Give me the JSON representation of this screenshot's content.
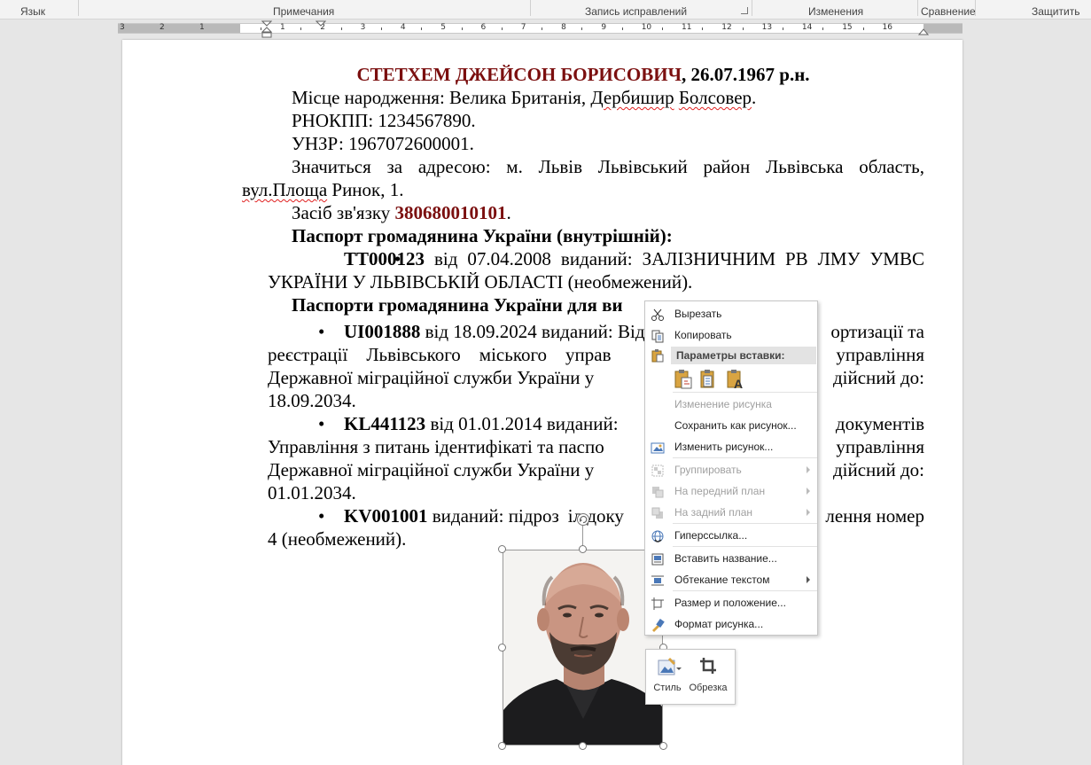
{
  "ribbon": {
    "groups": [
      "Язык",
      "Примечания",
      "Запись исправлений",
      "Изменения",
      "Сравнение",
      "Защитить"
    ]
  },
  "ruler": {
    "left_labels": [
      "3",
      "2",
      "1"
    ],
    "right_labels": [
      "1",
      "2",
      "3",
      "4",
      "5",
      "6",
      "7",
      "8",
      "9",
      "10",
      "11",
      "12",
      "13",
      "14",
      "15",
      "16"
    ]
  },
  "document": {
    "title_name": "СТЕТХЕМ ДЖЕЙСОН БОРИСОВИЧ",
    "title_date": ", 26.07.1967 р.н.",
    "birthplace_prefix": "Місце народження: Велика Британія, ",
    "birthplace_word1": "Дербишир",
    "birthplace_space": " ",
    "birthplace_word2": "Болсовер",
    "birthplace_end": ".",
    "rnokpp": "РНОКПП: 1234567890.",
    "unzr": "УНЗР: 1967072600001.",
    "address_line1": "Значиться за адресою: м. Львів Львівський район Львівська область,",
    "address_squig": "вул.Площа",
    "address_rest": " Ринок, 1.",
    "contact_prefix": "Засіб зв'язку ",
    "contact_number": "380680010101",
    "contact_end": ".",
    "passport_internal_header": "Паспорт громадянина України (внутрішній):",
    "passport_internal_num": "TT000123",
    "passport_internal_text": " від 07.04.2008 виданий: ЗАЛІЗНИЧНИМ РВ ЛМУ УМВС УКРАЇНИ У ЛЬВІВСЬКІЙ ОБЛАСТІ (необмежений).",
    "passport_foreign_header": "Паспорти громадянина України для ви",
    "p1_num": "UI001888",
    "p1_line1": " від 18.09.2024 виданий: Відділ",
    "p1_line1_tail": "ортизації та",
    "p1_line2": "реєстрації    Львівського    міського    управ",
    "p1_line2_tail": "управління",
    "p1_line3": "Державної міграційної служби України у",
    "p1_line3_tail": "дійсний до:",
    "p1_line4": "18.09.2034.",
    "p2_num": "KL441123",
    "p2_line1": " від 01.01.2014 виданий:",
    "p2_line1_tail": "документів",
    "p2_line2": "Управління з питань ідентифікаті та паспо",
    "p2_line2_tail": "управління",
    "p2_line3": "Державної міграційної служби України у",
    "p2_line3_tail": "дійсний до:",
    "p2_line4": "01.01.2034.",
    "p3_num": "KV001001",
    "p3_line1": " виданий: підроз",
    "p3_line1_mid": "іл доку",
    "p3_line1_tail": "лення номер",
    "p3_line2": "4 (необмежений)."
  },
  "context_menu": {
    "cut": "Вырезать",
    "copy": "Копировать",
    "paste_header": "Параметры вставки:",
    "change_picture": "Изменение рисунка",
    "save_as_picture": "Сохранить как рисунок...",
    "edit_picture": "Изменить рисунок...",
    "group": "Группировать",
    "bring_forward": "На передний план",
    "send_backward": "На задний план",
    "hyperlink": "Гиперссылка...",
    "insert_caption": "Вставить название...",
    "wrap_text": "Обтекание текстом",
    "size_position": "Размер и положение...",
    "format_picture": "Формат рисунка..."
  },
  "mini_toolbar": {
    "style": "Стиль",
    "crop": "Обрезка"
  },
  "colors": {
    "accent_red": "#7b0f0f"
  }
}
